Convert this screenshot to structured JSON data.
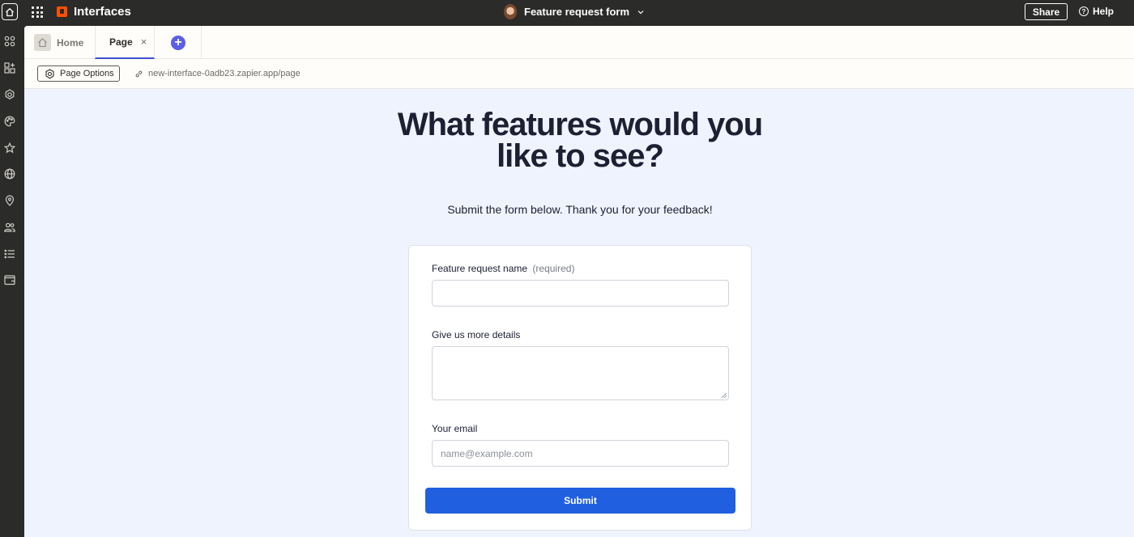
{
  "topbar": {
    "brand": "Interfaces",
    "form_title": "Feature request form",
    "share_label": "Share",
    "help_label": "Help"
  },
  "rail": {
    "icons": [
      "apps-icon",
      "blocks-icon",
      "settings-icon",
      "palette-icon",
      "star-icon",
      "globe-icon",
      "location-icon",
      "users-icon",
      "list-icon",
      "wallet-icon"
    ]
  },
  "tabs": {
    "home_label": "Home",
    "page_label": "Page",
    "close_glyph": "×",
    "add_glyph": "+"
  },
  "urlbar": {
    "page_options_label": "Page Options",
    "url": "new-interface-0adb23.zapier.app/page"
  },
  "page": {
    "headline": "What features would you like to see?",
    "subtitle": "Submit the form below. Thank you for your feedback!"
  },
  "form": {
    "field1_label": "Feature request name",
    "field1_required": "(required)",
    "field2_label": "Give us more details",
    "field3_label": "Your email",
    "field3_placeholder": "name@example.com",
    "submit_label": "Submit"
  },
  "colors": {
    "accent": "#1f5fe0",
    "tab_underline": "#3d4fd0",
    "add_button": "#5b5ee6",
    "brand_orange": "#ff4f00",
    "canvas": "#eff3fe"
  }
}
